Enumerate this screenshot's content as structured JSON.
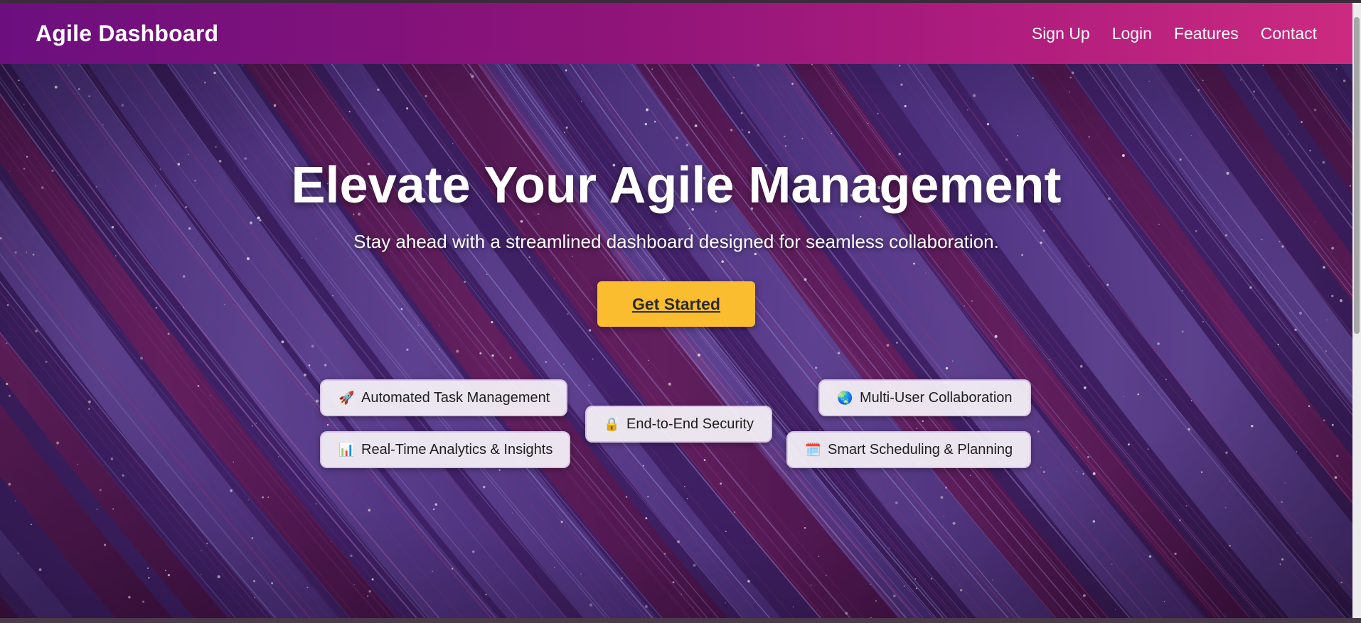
{
  "navbar": {
    "brand": "Agile Dashboard",
    "links": [
      "Sign Up",
      "Login",
      "Features",
      "Contact"
    ]
  },
  "hero": {
    "title": "Elevate Your Agile Management",
    "subtitle": "Stay ahead with a streamlined dashboard designed for seamless collaboration.",
    "cta_label": "Get Started"
  },
  "features": [
    {
      "icon": "rocket-icon",
      "glyph": "🚀",
      "label": "Automated Task Management"
    },
    {
      "icon": "bar-chart-icon",
      "glyph": "📊",
      "label": "Real-Time Analytics & Insights"
    },
    {
      "icon": "lock-icon",
      "glyph": "🔒",
      "label": "End-to-End Security"
    },
    {
      "icon": "globe-icon",
      "glyph": "🌏",
      "label": "Multi-User Collaboration"
    },
    {
      "icon": "calendar-icon",
      "glyph": "🗓️",
      "label": "Smart Scheduling & Planning"
    }
  ],
  "colors": {
    "navbar_start": "#6c0f7e",
    "navbar_end": "#cc2a80",
    "cta": "#fbbd30"
  }
}
